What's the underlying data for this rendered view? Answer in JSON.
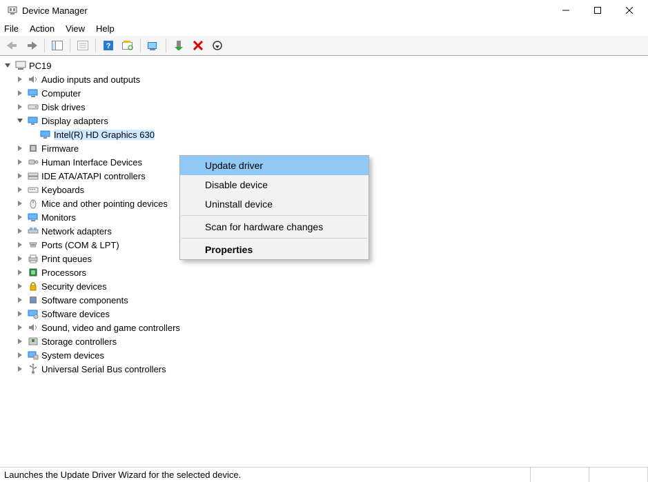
{
  "window": {
    "title": "Device Manager"
  },
  "menu": {
    "file": "File",
    "action": "Action",
    "view": "View",
    "help": "Help"
  },
  "tree": {
    "root": "PC19",
    "nodes": [
      {
        "id": "audio",
        "label": "Audio inputs and outputs"
      },
      {
        "id": "computer",
        "label": "Computer"
      },
      {
        "id": "disk",
        "label": "Disk drives"
      },
      {
        "id": "display",
        "label": "Display adapters",
        "expanded": true,
        "children": [
          {
            "id": "gpu",
            "label": "Intel(R) HD Graphics 630",
            "selected": true
          }
        ]
      },
      {
        "id": "firmware",
        "label": "Firmware"
      },
      {
        "id": "hid",
        "label": "Human Interface Devices"
      },
      {
        "id": "ide",
        "label": "IDE ATA/ATAPI controllers"
      },
      {
        "id": "keyboard",
        "label": "Keyboards"
      },
      {
        "id": "mice",
        "label": "Mice and other pointing devices"
      },
      {
        "id": "monitors",
        "label": "Monitors"
      },
      {
        "id": "network",
        "label": "Network adapters"
      },
      {
        "id": "ports",
        "label": "Ports (COM & LPT)"
      },
      {
        "id": "print",
        "label": "Print queues"
      },
      {
        "id": "proc",
        "label": "Processors"
      },
      {
        "id": "security",
        "label": "Security devices"
      },
      {
        "id": "swcomp",
        "label": "Software components"
      },
      {
        "id": "swdev",
        "label": "Software devices"
      },
      {
        "id": "sound",
        "label": "Sound, video and game controllers"
      },
      {
        "id": "storage",
        "label": "Storage controllers"
      },
      {
        "id": "system",
        "label": "System devices"
      },
      {
        "id": "usb",
        "label": "Universal Serial Bus controllers"
      }
    ]
  },
  "context_menu": {
    "update": "Update driver",
    "disable": "Disable device",
    "uninstall": "Uninstall device",
    "scan": "Scan for hardware changes",
    "properties": "Properties"
  },
  "status": {
    "text": "Launches the Update Driver Wizard for the selected device."
  }
}
